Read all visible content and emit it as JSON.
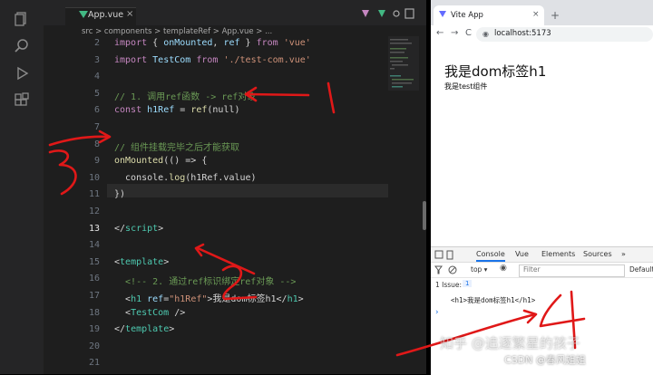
{
  "editor": {
    "tab_label": "App.vue",
    "breadcrumb": "src > components > templateRef > App.vue > ...",
    "lines": [
      {
        "n": "2",
        "html": "<span class='kw'>import</span> <span class='plain'>{ </span><span class='attr'>onMounted</span><span class='plain'>, </span><span class='attr'>ref</span><span class='plain'> } </span><span class='kw'>from</span> <span class='str'>'vue'</span>"
      },
      {
        "n": "3",
        "html": "<span class='kw'>import</span> <span class='attr'>TestCom</span> <span class='kw'>from</span> <span class='str'>'./test-com.vue'</span>"
      },
      {
        "n": "4",
        "html": ""
      },
      {
        "n": "5",
        "html": "<span class='cm'>// 1. 调用ref函数 -&gt; ref对象</span>"
      },
      {
        "n": "6",
        "html": "<span class='kw'>const</span> <span class='attr'>h1Ref</span> <span class='plain'>= </span><span class='fn'>ref</span><span class='plain'>(null)</span>"
      },
      {
        "n": "7",
        "html": ""
      },
      {
        "n": "8",
        "html": "<span class='cm'>// 组件挂载完毕之后才能获取</span>"
      },
      {
        "n": "9",
        "html": "<span class='fn'>onMounted</span><span class='plain'>(() =&gt; {</span>"
      },
      {
        "n": "10",
        "html": "<span class='plain'>  console.</span><span class='fn'>log</span><span class='plain'>(h1Ref.value)</span>"
      },
      {
        "n": "11",
        "html": "<span class='plain'>})</span>"
      },
      {
        "n": "12",
        "html": ""
      },
      {
        "n": "13",
        "html": "<span class='plain'>&lt;/</span><span class='tag'>script</span><span class='plain'>&gt;</span>"
      },
      {
        "n": "14",
        "html": ""
      },
      {
        "n": "15",
        "html": "<span class='plain'>&lt;</span><span class='tag'>template</span><span class='plain'>&gt;</span>"
      },
      {
        "n": "16",
        "html": "<span class='cm'>  &lt;!-- 2. 通过ref标识绑定ref对象 --&gt;</span>"
      },
      {
        "n": "17",
        "html": "<span class='plain'>  &lt;</span><span class='tag'>h1</span> <span class='attr'>ref</span><span class='plain'>=</span><span class='str'>\"h1Ref\"</span><span class='plain'>&gt;我是dom标签h1&lt;/</span><span class='tag'>h1</span><span class='plain'>&gt;</span>"
      },
      {
        "n": "18",
        "html": "<span class='plain'>  &lt;</span><span class='tag'>TestCom</span> <span class='plain'>/&gt;</span>"
      },
      {
        "n": "19",
        "html": "<span class='plain'>&lt;/</span><span class='tag'>template</span><span class='plain'>&gt;</span>"
      },
      {
        "n": "20",
        "html": ""
      },
      {
        "n": "21",
        "html": ""
      }
    ],
    "current_line": "13"
  },
  "browser": {
    "tab_title": "Vite App",
    "tab_close": "×",
    "new_tab": "+",
    "back": "←",
    "forward": "→",
    "reload": "C",
    "url": "localhost:5173",
    "h1_text": "我是dom标签h1",
    "component_text": "我是test组件"
  },
  "devtools": {
    "tabs": [
      "Console",
      "Vue",
      "Elements",
      "Sources",
      "»"
    ],
    "top_select": "top ▾",
    "filter_placeholder": "Filter",
    "default_levels": "Default",
    "issues_label": "1 Issue:",
    "issues_count": "1",
    "console_output": "<h1>我是dom标签h1</h1>",
    "prompt": "›"
  },
  "annotations": [
    "1",
    "2",
    "3",
    "4"
  ],
  "watermark": {
    "line1": "知乎 @追逐繁星的孩子",
    "line2": "CSDN @春风姐姐"
  },
  "colors": {
    "vue_green": "#42b883",
    "vite_purple": "#646cff",
    "annotation_red": "#e01818"
  }
}
